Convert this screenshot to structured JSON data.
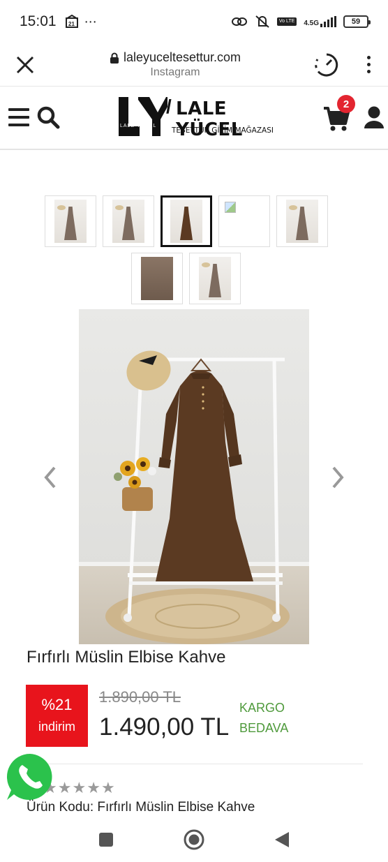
{
  "status_bar": {
    "time": "15:01",
    "network": "4.5G",
    "volte": "Vo LTE",
    "battery": "59"
  },
  "browser": {
    "url": "laleyuceltesettur.com",
    "source": "Instagram"
  },
  "site": {
    "logo_mark_text": "LALE YÜCEL",
    "logo_name": "LALE YÜCEL",
    "logo_tagline": "TESETTÜR GİYİM MAĞAZASI",
    "cart_count": "2"
  },
  "product": {
    "title": "Fırfırlı Müslin Elbise Kahve",
    "discount_percent": "%21",
    "discount_label": "indirim",
    "old_price": "1.890,00 TL",
    "new_price": "1.490,00 TL",
    "shipping_line1": "KARGO",
    "shipping_line2": "BEDAVA",
    "code_line": "Ürün Kodu: Fırfırlı Müslin Elbise Kahve",
    "rating_stars": 5
  },
  "gallery": {
    "thumbnail_count": 7,
    "active_index": 2,
    "broken_index": 3
  },
  "colors": {
    "discount_bg": "#e8141c",
    "shipping_green": "#4f9a3c",
    "badge_red": "#e32530",
    "dress_brown": "#5b3a22"
  }
}
